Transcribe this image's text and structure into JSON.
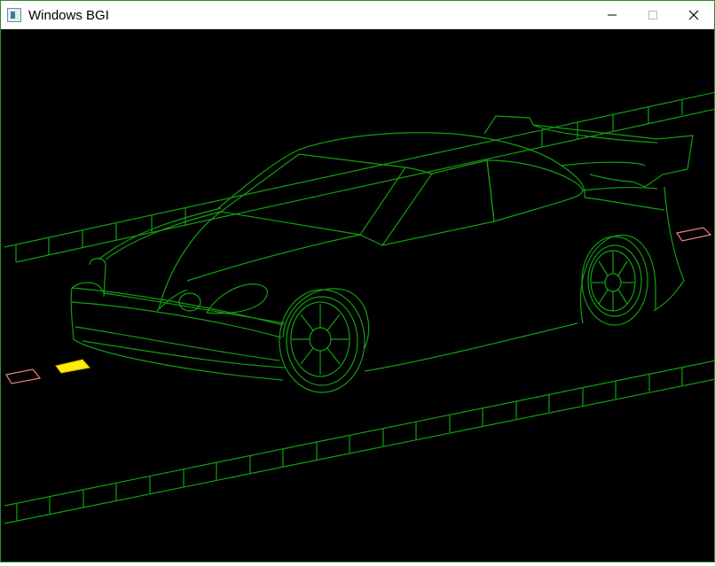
{
  "window": {
    "title": "Windows BGI",
    "controls": {
      "minimize": "minimize",
      "maximize": "maximize",
      "close": "close"
    }
  },
  "colors": {
    "line_green": "#12a012",
    "wheel_green": "#0fb20f",
    "reflector_pink": "#f08080",
    "reflector_yellow": "#ffee00",
    "background": "#000000"
  }
}
